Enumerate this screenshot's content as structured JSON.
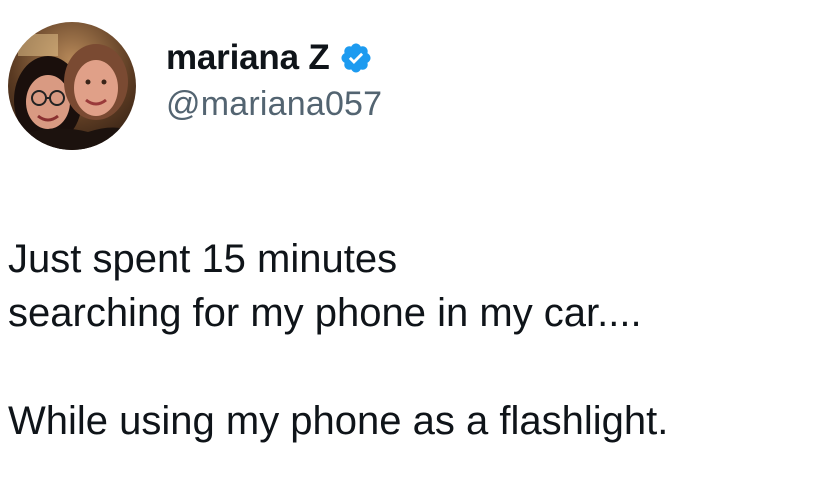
{
  "author": {
    "display_name": "mariana Z",
    "handle": "@mariana057",
    "verified": true,
    "verified_color": "#1d9bf0",
    "avatar_icon": "profile-photo-two-women"
  },
  "tweet": {
    "lines": [
      "Just spent 15 minutes",
      "searching for my phone in my car....",
      "",
      "While using my phone as a flashlight."
    ]
  },
  "colors": {
    "text": "#0f1419",
    "secondary": "#536471",
    "background": "#ffffff"
  }
}
